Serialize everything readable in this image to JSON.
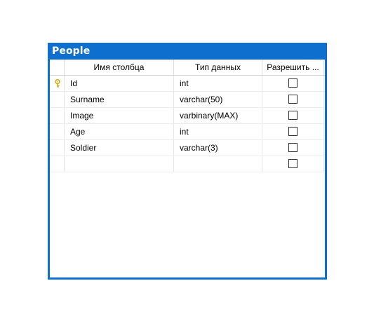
{
  "table": {
    "title": "People",
    "columns_header": {
      "name": "Имя столбца",
      "type": "Тип данных",
      "nulls": "Разрешить ..."
    },
    "rows": [
      {
        "name": "Id",
        "type": "int",
        "allow_nulls": false,
        "primary_key": true
      },
      {
        "name": "Surname",
        "type": "varchar(50)",
        "allow_nulls": false
      },
      {
        "name": "Image",
        "type": "varbinary(MAX)",
        "allow_nulls": false
      },
      {
        "name": "Age",
        "type": "int",
        "allow_nulls": false
      },
      {
        "name": "Soldier",
        "type": "varchar(3)",
        "allow_nulls": false
      },
      {
        "name": "",
        "type": "",
        "allow_nulls": false
      }
    ],
    "icons": {
      "primary_key": "key-icon"
    },
    "colors": {
      "title_bar": "#0f6fcf",
      "key_icon": "#e6c200"
    }
  }
}
